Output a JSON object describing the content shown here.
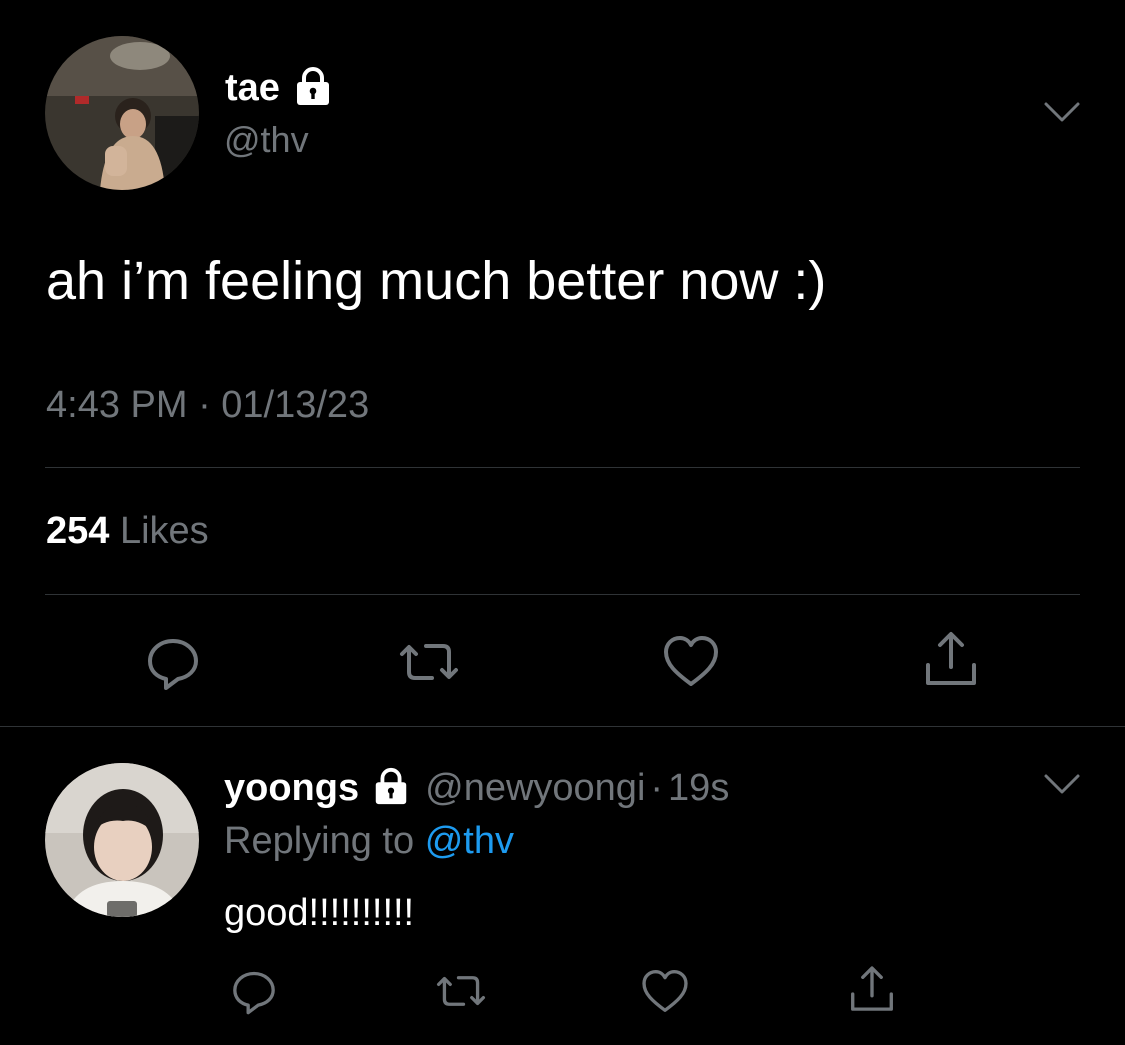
{
  "main_tweet": {
    "author": {
      "display_name": "tae",
      "handle": "@thv",
      "protected_icon": "lock-icon",
      "avatar": "profile-photo"
    },
    "text": "ah i’m feeling much better now :)",
    "timestamp": "4:43 PM · 01/13/23",
    "likes_count": "254",
    "likes_label": "Likes",
    "more_icon": "chevron-down-icon",
    "actions": [
      "reply-icon",
      "retweet-icon",
      "like-icon",
      "share-icon"
    ]
  },
  "reply": {
    "author": {
      "display_name": "yoongs",
      "handle": "@newyoongi",
      "separator": "·",
      "time": "19s",
      "protected_icon": "lock-icon",
      "avatar": "profile-photo"
    },
    "replying_to_label": "Replying to",
    "replying_to_handle": "@thv",
    "text": "good!!!!!!!!!!",
    "more_icon": "chevron-down-icon",
    "actions": [
      "reply-icon",
      "retweet-icon",
      "like-icon",
      "share-icon"
    ]
  },
  "colors": {
    "background": "#000000",
    "text": "#ffffff",
    "muted": "#71767b",
    "link": "#1d9bf0",
    "divider": "#2f3336"
  }
}
